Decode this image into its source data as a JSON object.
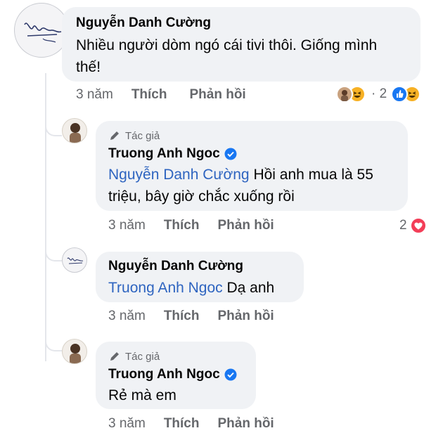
{
  "comments": [
    {
      "name": "Nguyễn Danh Cường",
      "text_line1": "Nhiều người dòm ngó cái tivi thôi. Giống mình",
      "text_line2": "thế!",
      "time": "3 năm",
      "like_label": "Thích",
      "reply_label": "Phản hồi",
      "reaction_count": "· 2"
    },
    {
      "author_badge": "Tác giả",
      "name": "Truong Anh Ngoc",
      "mention": "Nguyễn Danh Cường",
      "text_line1_rest": " Hồi anh mua là 55",
      "text_line2": "triệu, bây giờ chắc xuống rồi",
      "time": "3 năm",
      "like_label": "Thích",
      "reply_label": "Phản hồi",
      "reaction_count": "2"
    },
    {
      "name": "Nguyễn Danh Cường",
      "mention": "Truong Anh Ngoc",
      "text_rest": " Dạ anh",
      "time": "3 năm",
      "like_label": "Thích",
      "reply_label": "Phản hồi"
    },
    {
      "author_badge": "Tác giả",
      "name": "Truong Anh Ngoc",
      "text": "Rẻ mà em",
      "time": "3 năm",
      "like_label": "Thích",
      "reply_label": "Phản hồi"
    }
  ],
  "colors": {
    "bubble": "#f0f2f5",
    "mention": "#2e64c0",
    "like_blue": "#1877f2",
    "love_red": "#f33e58",
    "haha_yellow": "#f7b125",
    "muted": "#65676b"
  },
  "icons": [
    "signature-avatar",
    "person-avatar",
    "pencil-icon",
    "verified-badge-icon",
    "haha-reaction-icon",
    "like-reaction-icon",
    "love-reaction-icon"
  ]
}
